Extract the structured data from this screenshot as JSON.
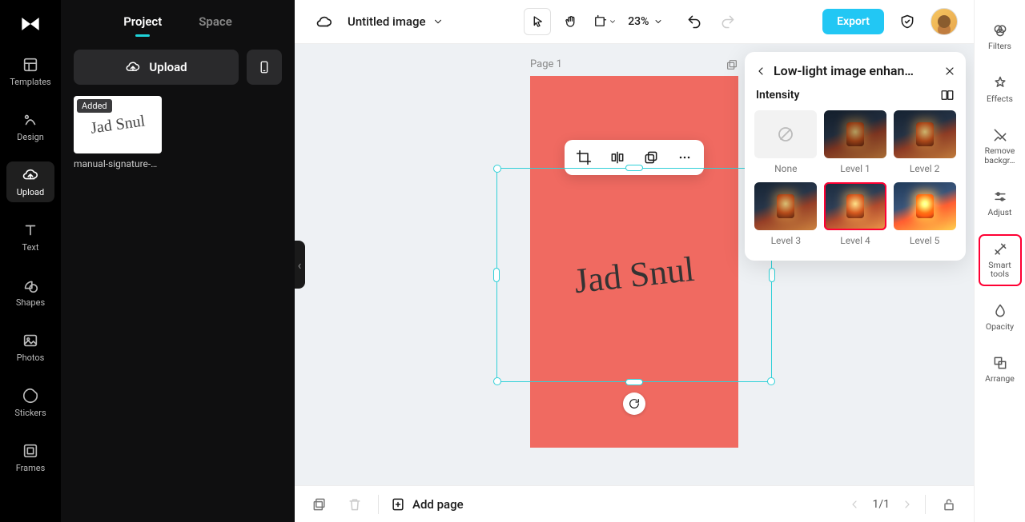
{
  "rail": {
    "items": [
      {
        "label": "Templates"
      },
      {
        "label": "Design"
      },
      {
        "label": "Upload"
      },
      {
        "label": "Text"
      },
      {
        "label": "Shapes"
      },
      {
        "label": "Photos"
      },
      {
        "label": "Stickers"
      },
      {
        "label": "Frames"
      }
    ]
  },
  "panel": {
    "tabs": {
      "project": "Project",
      "space": "Space"
    },
    "upload_label": "Upload",
    "asset_badge": "Added",
    "asset_name": "manual-signature-do…"
  },
  "topbar": {
    "title": "Untitled image",
    "zoom": "23%",
    "export": "Export"
  },
  "canvas": {
    "page_label": "Page 1"
  },
  "popup": {
    "title": "Low-light image enhan…",
    "subtitle": "Intensity",
    "options": [
      "None",
      "Level 1",
      "Level 2",
      "Level 3",
      "Level 4",
      "Level 5"
    ]
  },
  "proprail": {
    "items": [
      "Filters",
      "Effects",
      "Remove backgr…",
      "Adjust",
      "Smart tools",
      "Opacity",
      "Arrange"
    ]
  },
  "bottombar": {
    "add_page": "Add page",
    "pager": "1/1"
  }
}
